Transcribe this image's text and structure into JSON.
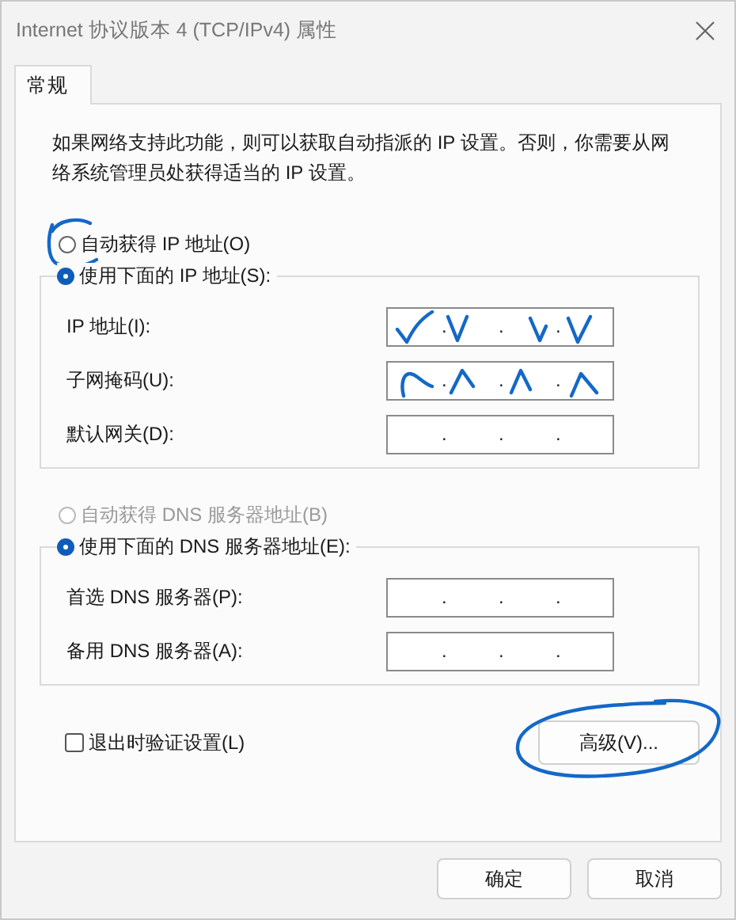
{
  "window": {
    "title": "Internet 协议版本 4 (TCP/IPv4) 属性"
  },
  "tabs": [
    {
      "label": "常规",
      "selected": true
    }
  ],
  "description": "如果网络支持此功能，则可以获取自动指派的 IP 设置。否则，你需要从网络系统管理员处获得适当的 IP 设置。",
  "ip_section": {
    "auto_option": {
      "label": "自动获得 IP 地址(O)",
      "selected": false,
      "disabled": false,
      "annotated": true
    },
    "manual_option": {
      "label": "使用下面的 IP 地址(S):",
      "selected": true,
      "disabled": false
    },
    "fields": [
      {
        "kind": "check",
        "label": "IP 地址(I):",
        "separators": [
          ".",
          ".",
          "."
        ]
      },
      {
        "kind": "peak",
        "label": "子网掩码(U):",
        "separators": [
          ".",
          ".",
          "."
        ]
      },
      {
        "kind": "plain",
        "label": "默认网关(D):",
        "separators": [
          ".",
          ".",
          "."
        ]
      }
    ]
  },
  "dns_section": {
    "auto_option": {
      "label": "自动获得 DNS 服务器地址(B)",
      "selected": false,
      "disabled": true,
      "annotated": false
    },
    "manual_option": {
      "label": "使用下面的 DNS 服务器地址(E):",
      "selected": true,
      "disabled": false
    },
    "fields": [
      {
        "label": "首选 DNS 服务器(P):",
        "separators": [
          ".",
          ".",
          "."
        ]
      },
      {
        "label": "备用 DNS 服务器(A):",
        "separators": [
          ".",
          ".",
          "."
        ]
      }
    ]
  },
  "validate_checkbox": {
    "label": "退出时验证设置(L)",
    "checked": false
  },
  "advanced_button": {
    "label": "高级(V)...",
    "annotated": true
  },
  "buttons": [
    "确定",
    "取消"
  ]
}
